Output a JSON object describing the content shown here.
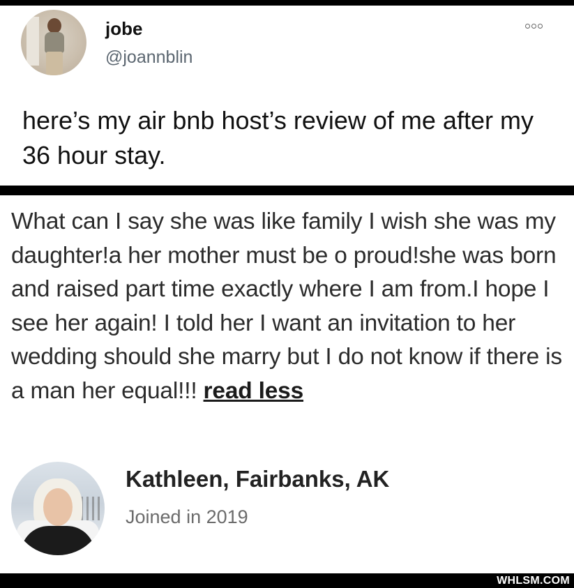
{
  "tweet": {
    "display_name": "jobe",
    "handle": "@joannblin",
    "text": "here’s my air bnb host’s review of me after my 36 hour stay."
  },
  "review": {
    "body": "What can I say she was like family I wish she was my daughter!a her mother must be o proud!she was born and raised part time exactly where I am from.I hope I see her again! I told her I want an invitation to her wedding should she marry but I do not know if there is a man her equal!!!",
    "read_less_label": "read less",
    "host_name": "Kathleen, Fairbanks, AK",
    "joined": "Joined in 2019"
  },
  "watermark": "WHLSM.COM"
}
